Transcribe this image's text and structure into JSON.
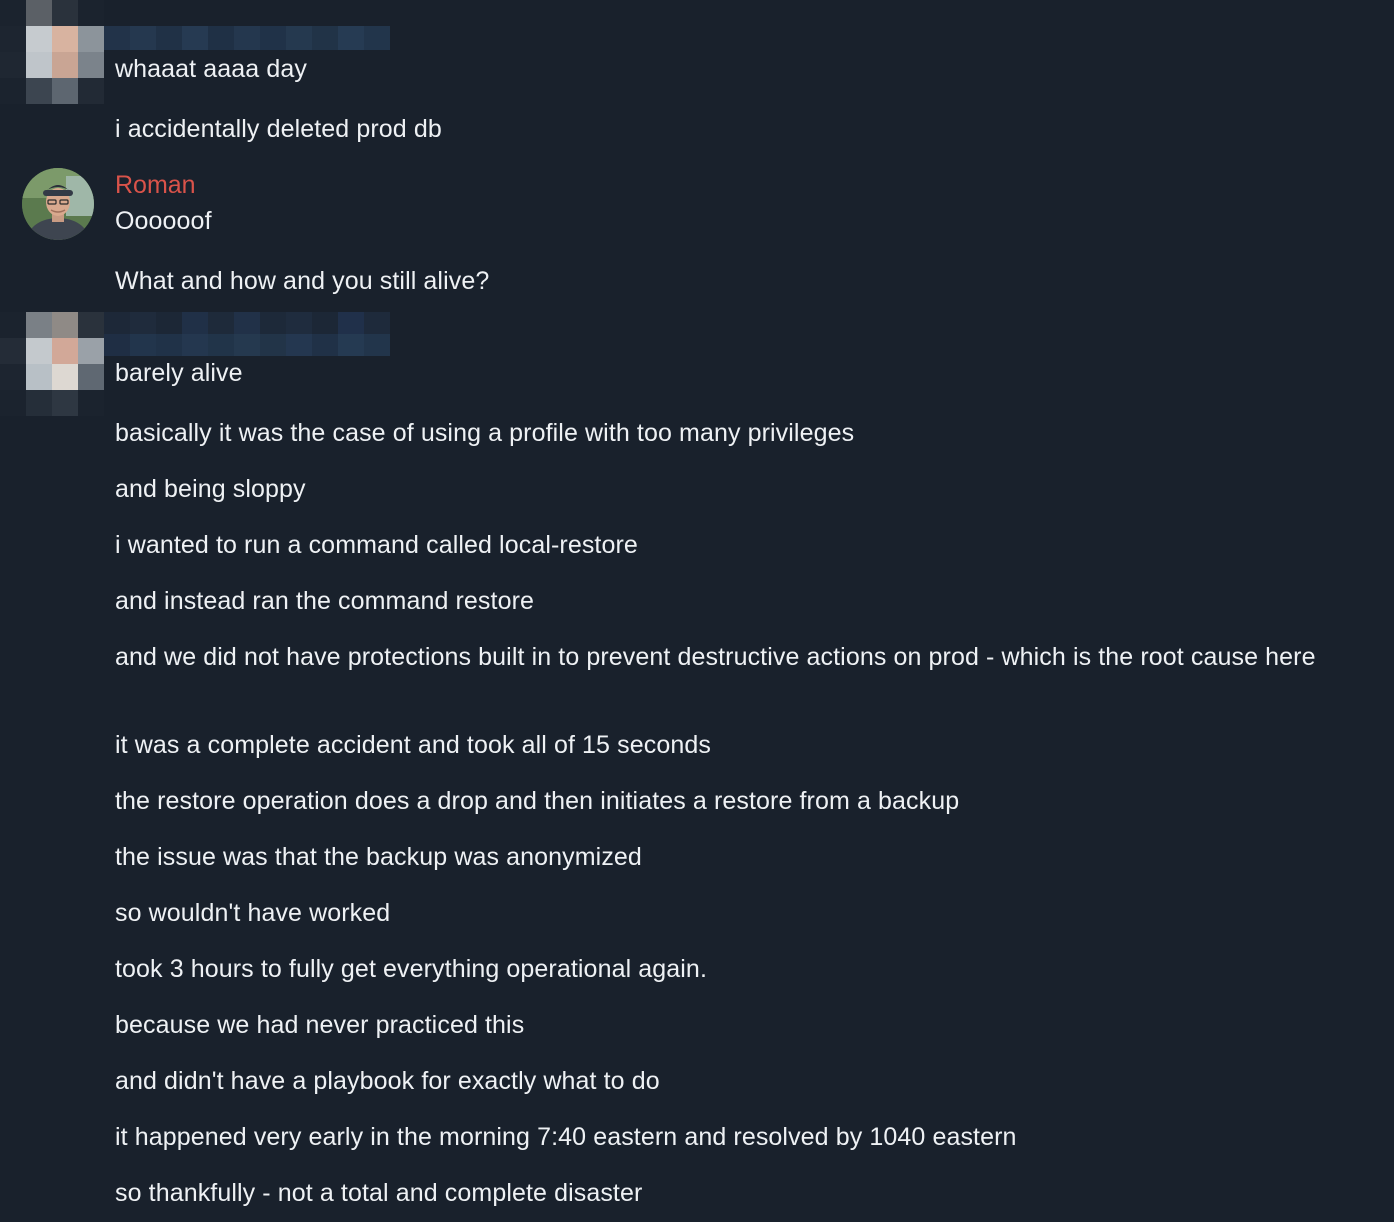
{
  "conversation": {
    "groups": [
      {
        "sender": "",
        "avatar": "blurred-avatar",
        "messages": [
          "whaaat aaaa day",
          "i accidentally deleted prod db"
        ]
      },
      {
        "sender": "Roman",
        "sender_color": "#d9534a",
        "avatar": "profile-photo",
        "messages": [
          "Oooooof",
          "What and how and you still alive?"
        ]
      },
      {
        "sender": "",
        "avatar": "blurred-avatar",
        "messages": [
          "barely alive",
          "basically it was the case of using a profile with too many privileges",
          "and being sloppy",
          "i wanted to run a command called local-restore",
          "and instead ran the command restore",
          "and we did not have protections built in to prevent destructive actions on prod - which is the root cause here",
          "it was a complete accident and took all of 15 seconds",
          "the restore operation does a drop and then initiates a restore from a backup",
          "the issue was that the backup was anonymized",
          "so wouldn't have worked",
          "took 3 hours to fully get everything operational again.",
          "because we had never practiced this",
          "and didn't have a playbook for exactly what to do",
          "it happened very early in the morning 7:40 eastern and resolved by 1040 eastern",
          "so thankfully - not a total and complete disaster"
        ]
      }
    ]
  },
  "colors": {
    "background": "#19212c",
    "text": "#eef1f4",
    "sender_name": "#d9534a"
  }
}
